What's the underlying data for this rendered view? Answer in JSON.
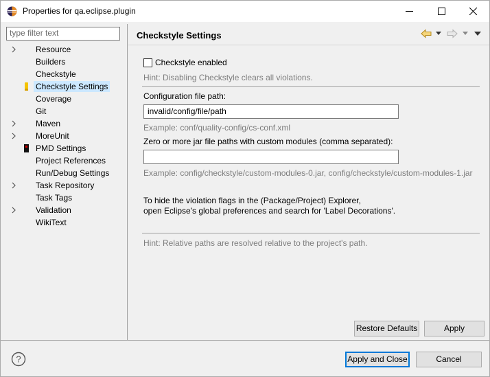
{
  "window": {
    "title": "Properties for qa.eclipse.plugin",
    "controls": [
      "minimize",
      "maximize",
      "close"
    ]
  },
  "filter": {
    "placeholder": "type filter text"
  },
  "tree": {
    "items": [
      {
        "label": "Resource",
        "expandable": true,
        "icon": ""
      },
      {
        "label": "Builders",
        "expandable": false,
        "icon": ""
      },
      {
        "label": "Checkstyle",
        "expandable": false,
        "icon": ""
      },
      {
        "label": "Checkstyle Settings",
        "expandable": false,
        "icon": "checkstyle-icon",
        "selected": true
      },
      {
        "label": "Coverage",
        "expandable": false,
        "icon": ""
      },
      {
        "label": "Git",
        "expandable": false,
        "icon": ""
      },
      {
        "label": "Maven",
        "expandable": true,
        "icon": ""
      },
      {
        "label": "MoreUnit",
        "expandable": true,
        "icon": ""
      },
      {
        "label": "PMD Settings",
        "expandable": false,
        "icon": "pmd-icon"
      },
      {
        "label": "Project References",
        "expandable": false,
        "icon": ""
      },
      {
        "label": "Run/Debug Settings",
        "expandable": false,
        "icon": ""
      },
      {
        "label": "Task Repository",
        "expandable": true,
        "icon": ""
      },
      {
        "label": "Task Tags",
        "expandable": false,
        "icon": ""
      },
      {
        "label": "Validation",
        "expandable": true,
        "icon": ""
      },
      {
        "label": "WikiText",
        "expandable": false,
        "icon": ""
      }
    ]
  },
  "page": {
    "title": "Checkstyle Settings",
    "checkstyle_enabled_label": "Checkstyle enabled",
    "checkstyle_enabled": false,
    "hint_disable": "Hint: Disabling Checkstyle clears all violations.",
    "config_path_label": "Configuration file path:",
    "config_path_value": "invalid/config/file/path",
    "config_path_example": "Example: conf/quality-config/cs-conf.xml",
    "jar_paths_label": "Zero or more jar file paths with custom modules (comma separated):",
    "jar_paths_value": "",
    "jar_paths_example": "Example: config/checkstyle/custom-modules-0.jar, config/checkstyle/custom-modules-1.jar",
    "violation_note_line1": "To hide the violation flags in the (Package/Project) Explorer,",
    "violation_note_line2": "open Eclipse's global preferences and search for 'Label Decorations'.",
    "hint_relative": "Hint: Relative paths are resolved relative to the project's path."
  },
  "buttons": {
    "restore_defaults": "Restore Defaults",
    "apply": "Apply",
    "apply_and_close": "Apply and Close",
    "cancel": "Cancel"
  },
  "colors": {
    "selection": "#cce8ff",
    "hint_text": "#7d7d7d",
    "accent": "#0078d7"
  }
}
